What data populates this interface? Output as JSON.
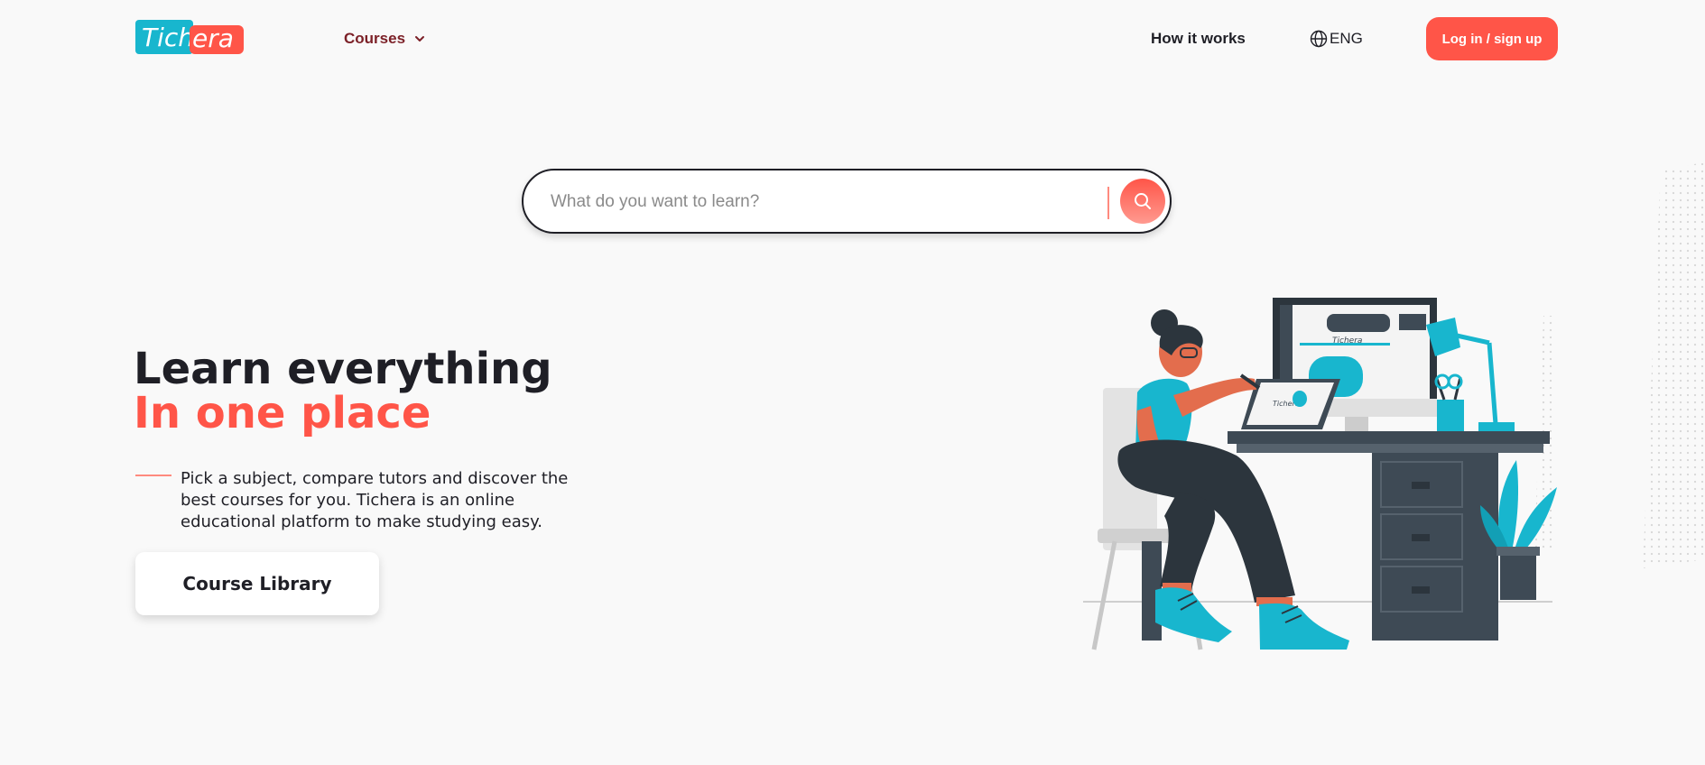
{
  "header": {
    "logo_part1": "Tich",
    "logo_part2": "era",
    "courses_label": "Courses",
    "how_it_works_label": "How it works",
    "language_label": "ENG",
    "login_label": "Log in / sign up"
  },
  "search": {
    "placeholder": "What do you want to learn?"
  },
  "hero": {
    "title_line1": "Learn everything",
    "title_line2": "In one place",
    "description": "Pick a subject, compare tutors and discover the best courses for you. Tichera is an online educational platform to make studying easy.",
    "library_button": "Course Library"
  },
  "illustration": {
    "screen_text": "Tichera",
    "tablet_text": "Tichera"
  },
  "colors": {
    "accent": "#ff5548",
    "brand_blue": "#18b6ce",
    "dark": "#1f1f26",
    "courses_text": "#7c2128"
  },
  "icons": {
    "courses_chevron": "chevron-down-icon",
    "language": "globe-icon",
    "search": "search-icon"
  }
}
